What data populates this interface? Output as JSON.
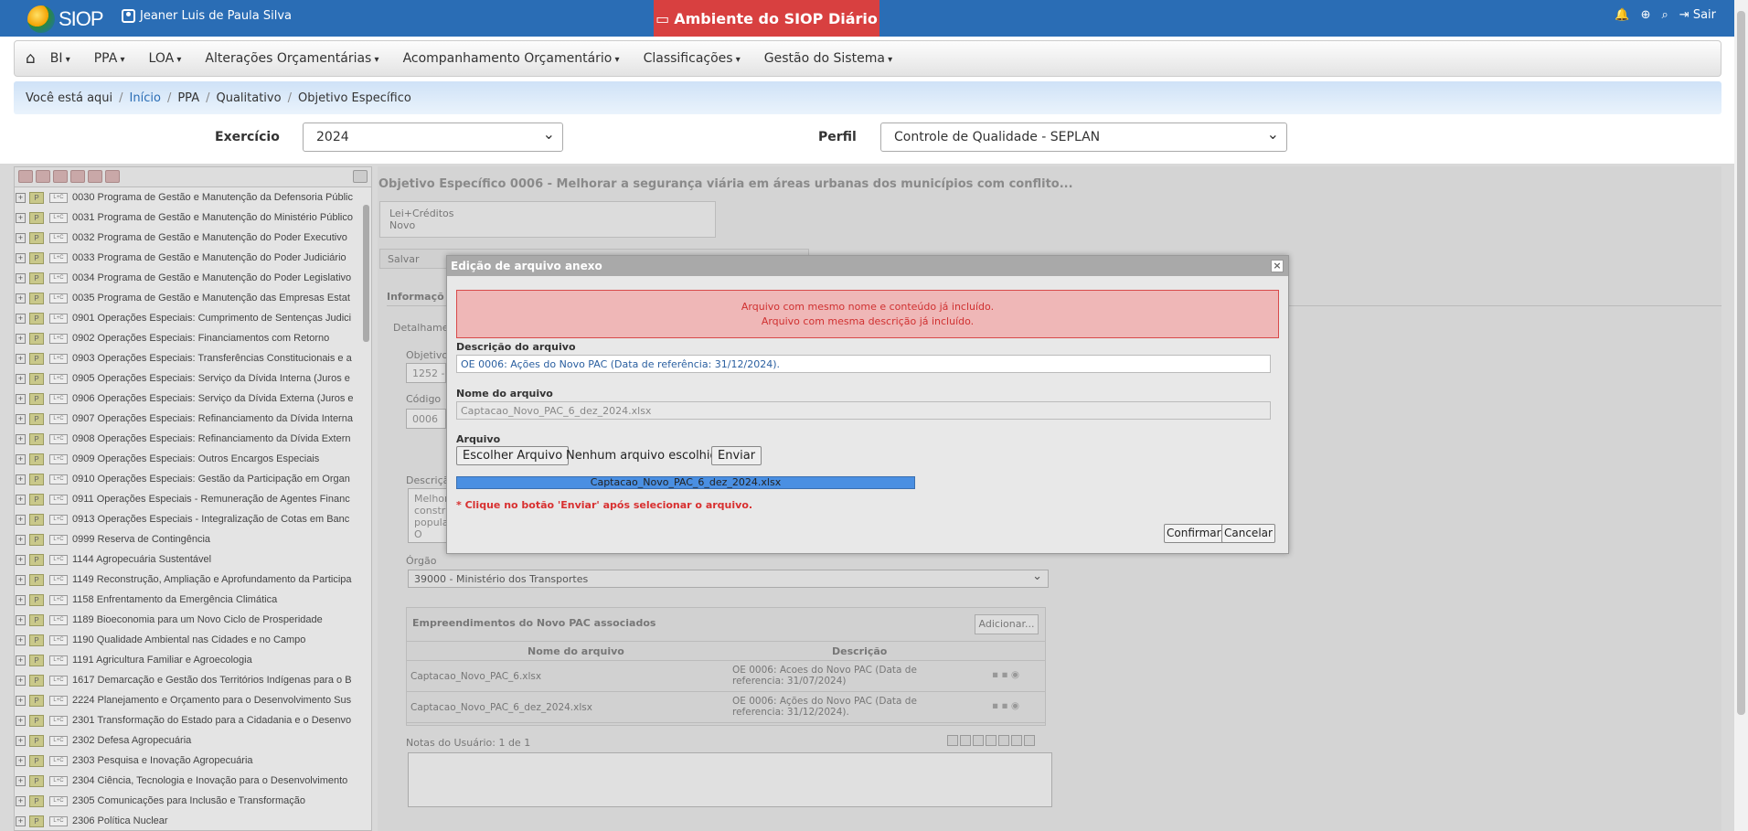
{
  "topbar": {
    "logo": "SIOP",
    "user": "Jeaner Luis de Paula Silva",
    "environment": "Ambiente do SIOP Diário",
    "logout": "Sair"
  },
  "nav": {
    "items": [
      "BI",
      "PPA",
      "LOA",
      "Alterações Orçamentárias",
      "Acompanhamento Orçamentário",
      "Classificações",
      "Gestão do Sistema"
    ]
  },
  "breadcrumb": {
    "prefix": "Você está aqui",
    "items": [
      "Início",
      "PPA",
      "Qualitativo",
      "Objetivo Específico"
    ]
  },
  "filters": {
    "exercicio_label": "Exercício",
    "exercicio_value": "2024",
    "perfil_label": "Perfil",
    "perfil_value": "Controle de Qualidade - SEPLAN"
  },
  "tree": [
    {
      "p": "P",
      "loa": "L+C",
      "label": "0030 Programa de Gestão e Manutenção da Defensoria Públic"
    },
    {
      "p": "P",
      "loa": "L+C",
      "label": "0031 Programa de Gestão e Manutenção do Ministério Público"
    },
    {
      "p": "P",
      "loa": "L+C",
      "label": "0032 Programa de Gestão e Manutenção do Poder Executivo"
    },
    {
      "p": "P",
      "loa": "L+C",
      "label": "0033 Programa de Gestão e Manutenção do Poder Judiciário"
    },
    {
      "p": "P",
      "loa": "L+C",
      "label": "0034 Programa de Gestão e Manutenção do Poder Legislativo"
    },
    {
      "p": "P",
      "loa": "L+C",
      "label": "0035 Programa de Gestão e Manutenção das Empresas Estat"
    },
    {
      "p": "P",
      "loa": "L+C",
      "label": "0901 Operações Especiais: Cumprimento de Sentenças Judici"
    },
    {
      "p": "P",
      "loa": "L+C",
      "label": "0902 Operações Especiais: Financiamentos com Retorno"
    },
    {
      "p": "P",
      "loa": "L+C",
      "label": "0903 Operações Especiais: Transferências Constitucionais e a"
    },
    {
      "p": "P",
      "loa": "L+C",
      "label": "0905 Operações Especiais: Serviço da Dívida Interna (Juros e"
    },
    {
      "p": "P",
      "loa": "L+C",
      "label": "0906 Operações Especiais: Serviço da Dívida Externa (Juros e"
    },
    {
      "p": "P",
      "loa": "L+C",
      "label": "0907 Operações Especiais: Refinanciamento da Dívida Interna"
    },
    {
      "p": "P",
      "loa": "L+C",
      "label": "0908 Operações Especiais: Refinanciamento da Dívida Extern"
    },
    {
      "p": "P",
      "loa": "L+C",
      "label": "0909 Operações Especiais: Outros Encargos Especiais"
    },
    {
      "p": "P",
      "loa": "L+C",
      "label": "0910 Operações Especiais: Gestão da Participação em Organ"
    },
    {
      "p": "P",
      "loa": "L+C",
      "label": "0911 Operações Especiais - Remuneração de Agentes Financ"
    },
    {
      "p": "P",
      "loa": "L+C",
      "label": "0913 Operações Especiais - Integralização de Cotas em Banc"
    },
    {
      "p": "P",
      "loa": "L+C",
      "label": "0999 Reserva de Contingência"
    },
    {
      "p": "P",
      "loa": "L+C",
      "label": "1144 Agropecuária Sustentável"
    },
    {
      "p": "P",
      "loa": "L+C",
      "label": "1149 Reconstrução, Ampliação e Aprofundamento da Participa"
    },
    {
      "p": "P",
      "loa": "L+C",
      "label": "1158 Enfrentamento da Emergência Climática"
    },
    {
      "p": "P",
      "loa": "L+C",
      "label": "1189 Bioeconomia para um Novo Ciclo de Prosperidade"
    },
    {
      "p": "P",
      "loa": "L+C",
      "label": "1190 Qualidade Ambiental nas Cidades e no Campo"
    },
    {
      "p": "P",
      "loa": "L+C",
      "label": "1191 Agricultura Familiar e Agroecologia"
    },
    {
      "p": "P",
      "loa": "L+C",
      "label": "1617 Demarcação e Gestão dos Territórios Indígenas para o B"
    },
    {
      "p": "P",
      "loa": "L+C",
      "label": "2224 Planejamento e Orçamento para o Desenvolvimento Sus"
    },
    {
      "p": "P",
      "loa": "L+C",
      "label": "2301 Transformação do Estado para a Cidadania e o Desenvo"
    },
    {
      "p": "P",
      "loa": "L+C",
      "label": "2302 Defesa Agropecuária"
    },
    {
      "p": "P",
      "loa": "L+C",
      "label": "2303 Pesquisa e Inovação Agropecuária"
    },
    {
      "p": "P",
      "loa": "L+C",
      "label": "2304 Ciência, Tecnologia e Inovação para o Desenvolvimento"
    },
    {
      "p": "P",
      "loa": "L+C",
      "label": "2305 Comunicações para Inclusão e Transformação"
    },
    {
      "p": "P",
      "loa": "L+C",
      "label": "2306 Política Nuclear"
    }
  ],
  "main": {
    "title": "Objetivo Específico 0006 - Melhorar a segurança viária em áreas urbanas dos municípios com conflito...",
    "lei_creditos": "Lei+Créditos",
    "novo": "Novo",
    "save": "Salvar",
    "tab_info": "Informaçõ",
    "detalhamento": "Detalhame",
    "objetivo_label": "Objetivo",
    "objetivo_value": "1252 -",
    "codigo_label": "Código",
    "codigo_value": "0006",
    "descricao_label": "Descriçã",
    "descricao_value": "Melhora construç popula O valor ferroviá",
    "orgao_label": "Órgão",
    "orgao_value": "39000 - Ministério dos Transportes",
    "emp_title": "Empreendimentos do Novo PAC associados",
    "emp_add": "Adicionar...",
    "emp_col_nome": "Nome do arquivo",
    "emp_col_desc": "Descrição",
    "emp_rows": [
      {
        "nome": "Captacao_Novo_PAC_6.xlsx",
        "desc": "OE 0006: Acoes do Novo PAC (Data de referencia: 31/07/2024)"
      },
      {
        "nome": "Captacao_Novo_PAC_6_dez_2024.xlsx",
        "desc": "OE 0006: Ações do Novo PAC (Data de referencia: 31/12/2024)."
      }
    ],
    "notes_label": "Notas do Usuário: 1 de 1"
  },
  "modal": {
    "title": "Edição de arquivo anexo",
    "error1": "Arquivo com mesmo nome e conteúdo já incluído.",
    "error2": "Arquivo com mesma descrição já incluído.",
    "desc_label": "Descrição do arquivo",
    "desc_value": "OE 0006: Ações do Novo PAC (Data de referência: 31/12/2024).",
    "name_label": "Nome do arquivo",
    "name_value": "Captacao_Novo_PAC_6_dez_2024.xlsx",
    "file_label": "Arquivo",
    "choose": "Escolher Arquivo",
    "no_file": "Nenhum arquivo escolhido",
    "send": "Enviar",
    "progress_file": "Captacao_Novo_PAC_6_dez_2024.xlsx",
    "progress": 1.0,
    "hint": "* Clique no botão 'Enviar' após selecionar o arquivo.",
    "confirm": "Confirmar",
    "cancel": "Cancelar"
  }
}
